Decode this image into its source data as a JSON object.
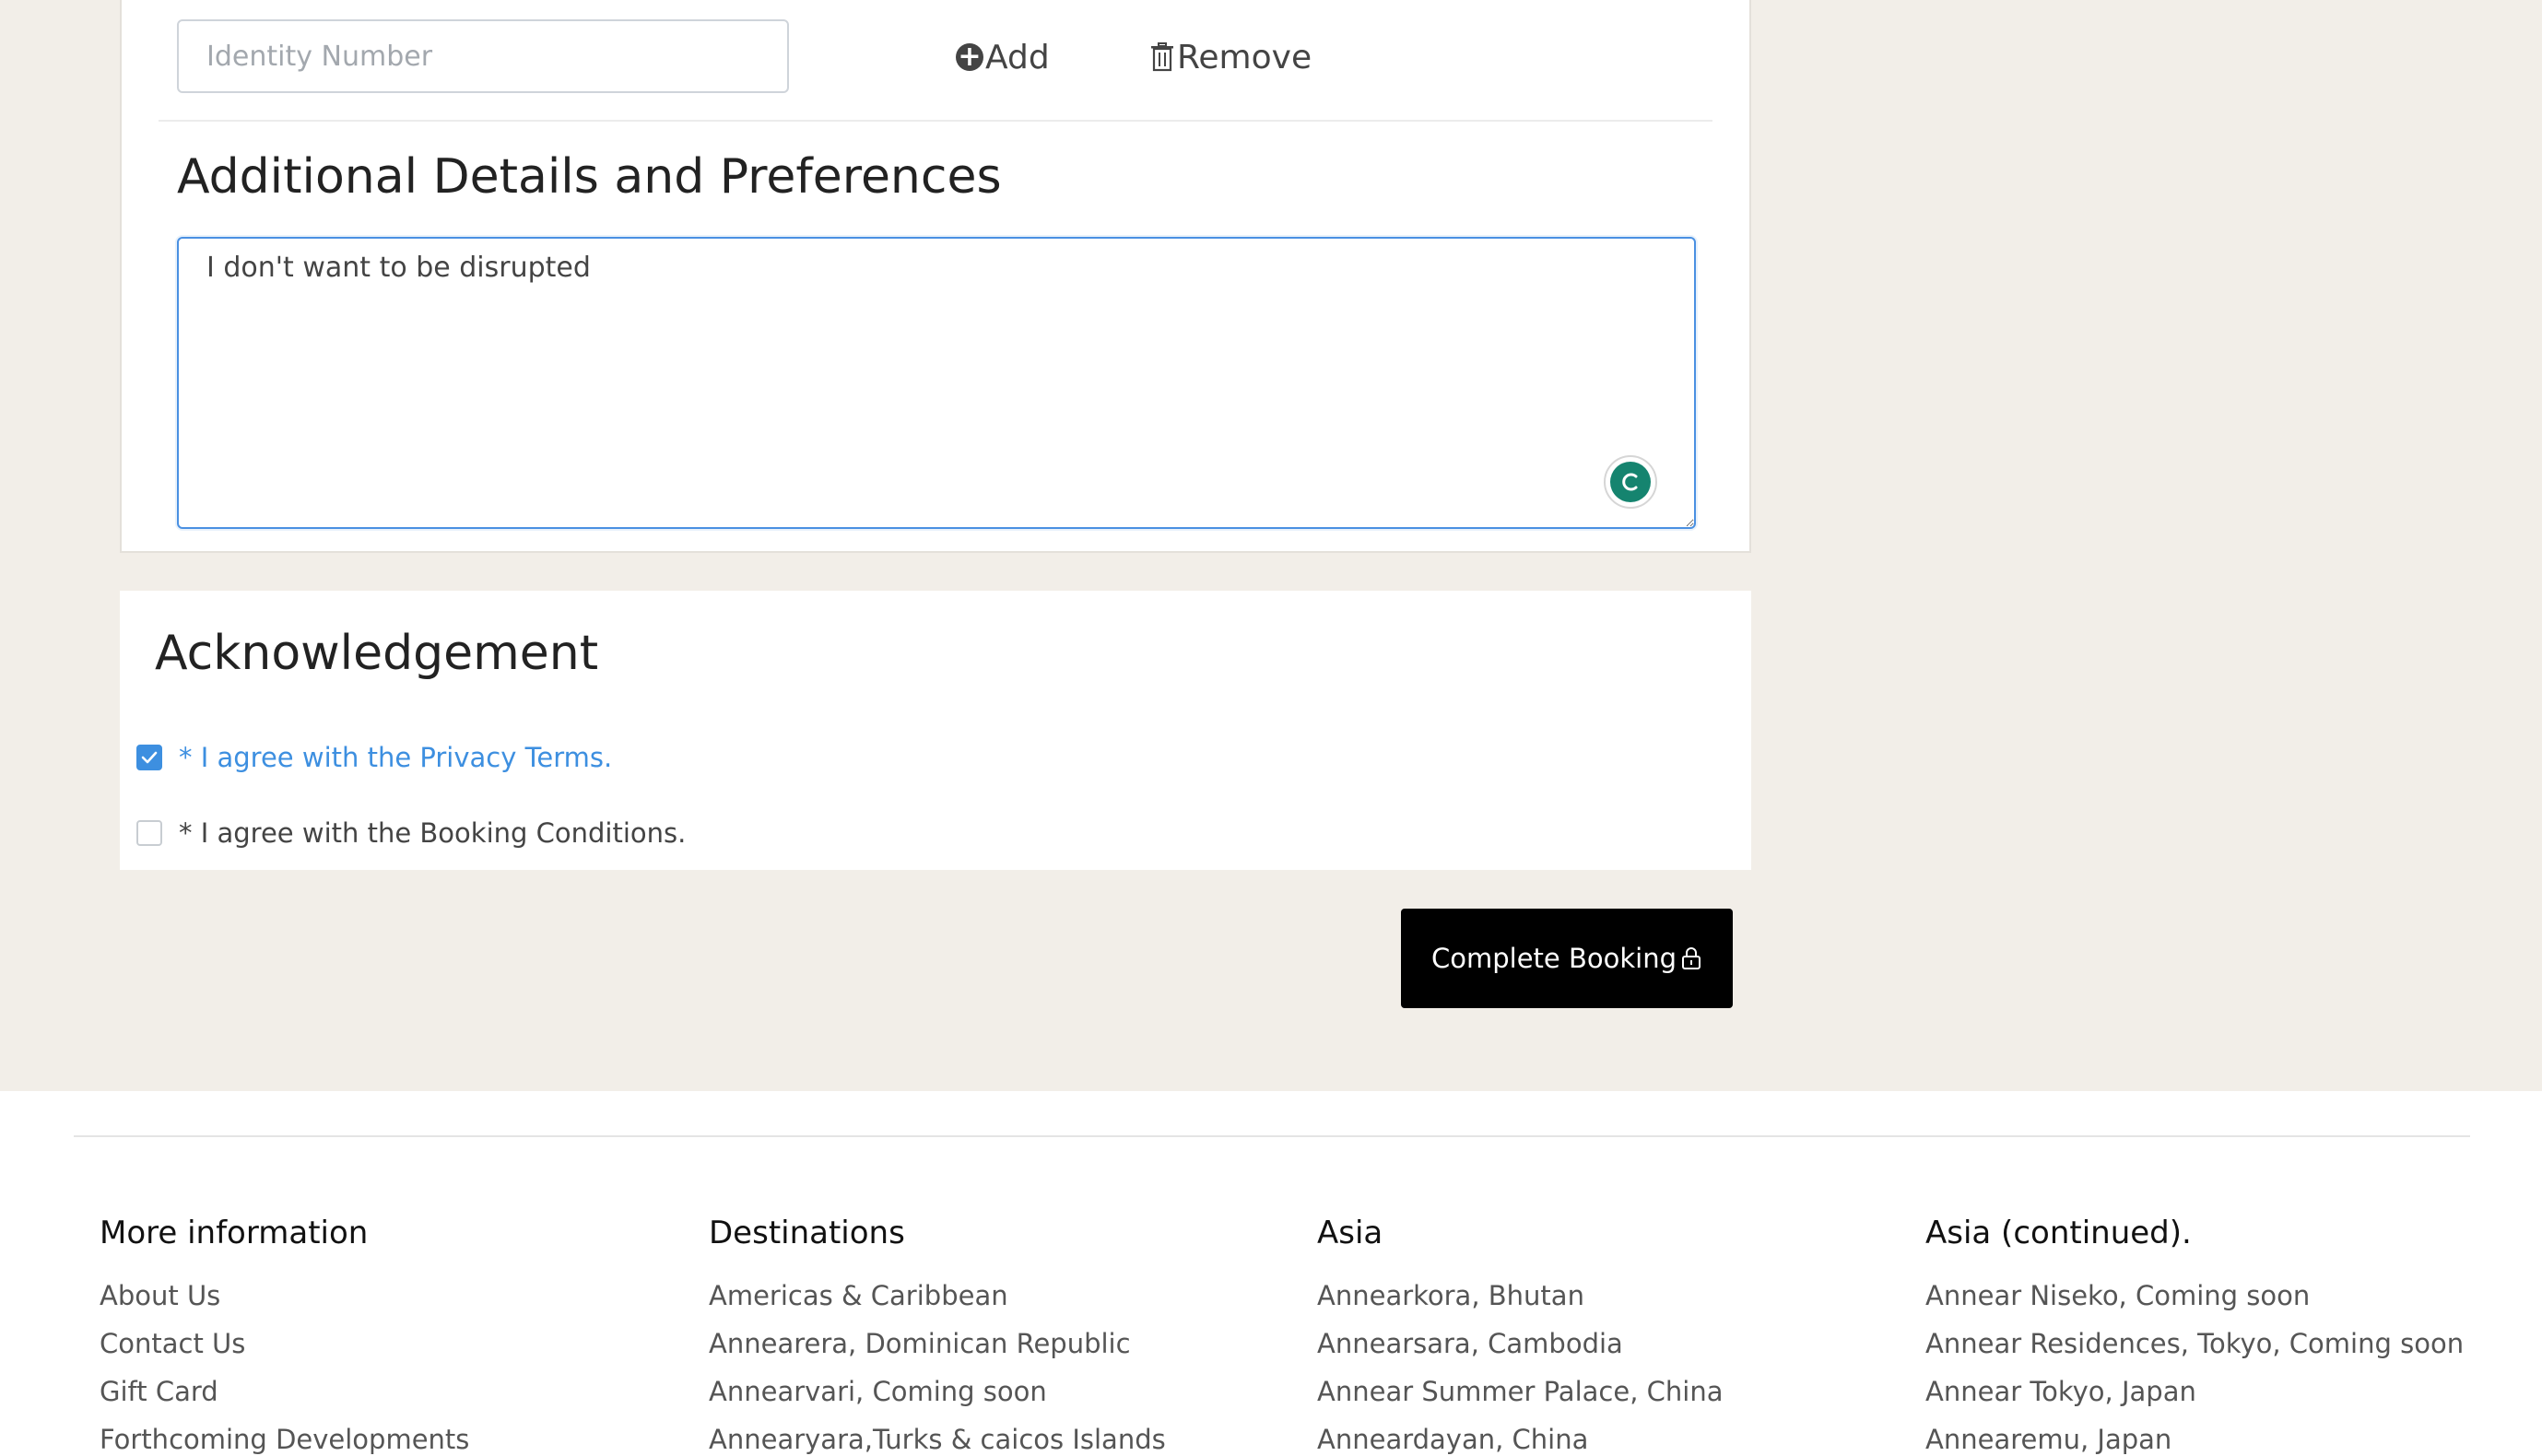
{
  "traveller": {
    "identity_placeholder": "Identity Number",
    "add_label": "Add",
    "remove_label": "Remove"
  },
  "additional": {
    "title": "Additional Details and Preferences",
    "textarea_value": "I don't want to be disrupted"
  },
  "acknowledgement": {
    "title": "Acknowledgement",
    "privacy_label": "* I agree with the Privacy Terms.",
    "privacy_checked": true,
    "booking_label": "* I agree with the Booking Conditions.",
    "booking_checked": false
  },
  "complete_button": {
    "label": "Complete Booking"
  },
  "footer": {
    "columns": [
      {
        "title": "More information",
        "links": [
          "About Us",
          "Contact Us",
          "Gift Card",
          "Forthcoming Developments"
        ]
      },
      {
        "title": "Destinations",
        "links": [
          "Americas & Caribbean",
          "Annearera, Dominican Republic",
          "Annearvari, Coming soon",
          "Annearyara,Turks & caicos Islands"
        ]
      },
      {
        "title": "Asia",
        "links": [
          "Annearkora, Bhutan",
          "Annearsara, Cambodia",
          "Annear Summer Palace, China",
          "Anneardayan, China"
        ]
      },
      {
        "title": "Asia (continued).",
        "links": [
          "Annear Niseko, Coming soon",
          "Annear Residences, Tokyo, Coming soon",
          "Annear Tokyo, Japan",
          "Annearemu, Japan"
        ]
      }
    ]
  },
  "colors": {
    "page_background": "#f2eee8",
    "accent_blue": "#3d8fe0",
    "button_black": "#000000",
    "grammar_green": "#15846f"
  }
}
